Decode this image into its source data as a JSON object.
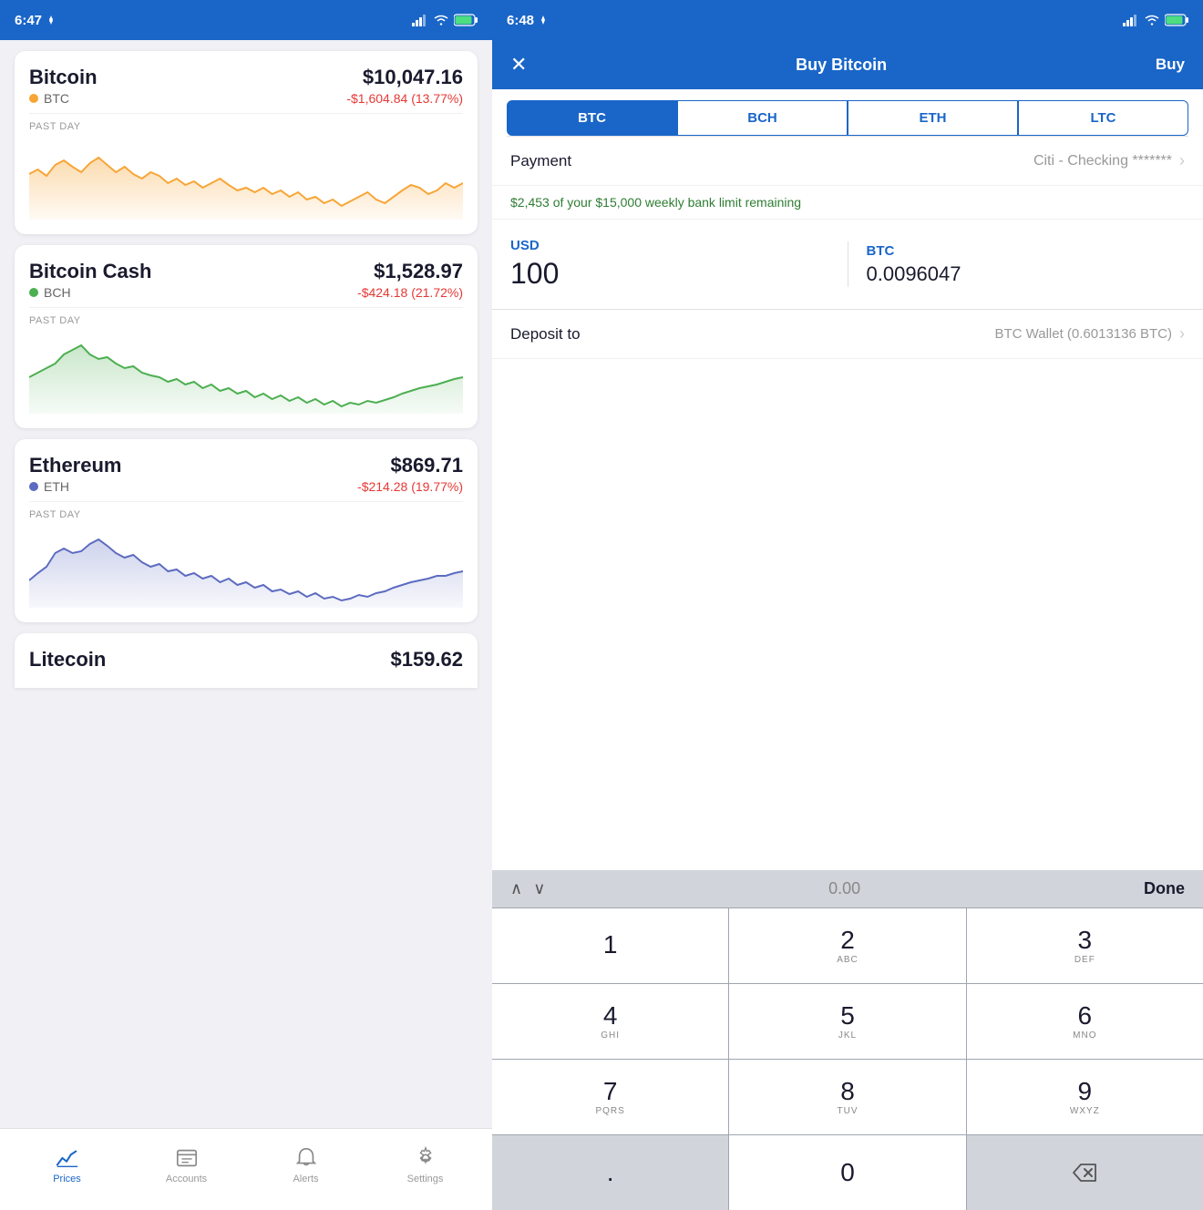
{
  "left": {
    "status_bar": {
      "time": "6:47",
      "location_icon": "location-arrow-icon",
      "signal_icon": "signal-icon",
      "wifi_icon": "wifi-icon",
      "battery_icon": "battery-icon"
    },
    "coins": [
      {
        "name": "Bitcoin",
        "ticker": "BTC",
        "dot_color": "#f7a535",
        "price": "$10,047.16",
        "change": "-$1,604.84 (13.77%)",
        "past_day_label": "PAST DAY",
        "chart_color": "#f7a535",
        "chart_fill": "#fef3dc"
      },
      {
        "name": "Bitcoin Cash",
        "ticker": "BCH",
        "dot_color": "#4caf50",
        "price": "$1,528.97",
        "change": "-$424.18 (21.72%)",
        "past_day_label": "PAST DAY",
        "chart_color": "#4caf50",
        "chart_fill": "#e8f5e9"
      },
      {
        "name": "Ethereum",
        "ticker": "ETH",
        "dot_color": "#5c6bc0",
        "price": "$869.71",
        "change": "-$214.28 (19.77%)",
        "past_day_label": "PAST DAY",
        "chart_color": "#6070c8",
        "chart_fill": "#e8eaf6"
      }
    ],
    "litecoin_partial": {
      "name": "Litecoin",
      "price": "$159.62"
    },
    "bottom_nav": [
      {
        "label": "Prices",
        "active": true,
        "icon": "prices-icon"
      },
      {
        "label": "Accounts",
        "active": false,
        "icon": "accounts-icon"
      },
      {
        "label": "Alerts",
        "active": false,
        "icon": "alerts-icon"
      },
      {
        "label": "Settings",
        "active": false,
        "icon": "settings-icon"
      }
    ]
  },
  "right": {
    "status_bar": {
      "time": "6:48",
      "location_icon": "location-arrow-icon",
      "signal_icon": "signal-icon",
      "wifi_icon": "wifi-icon",
      "battery_icon": "battery-icon"
    },
    "header": {
      "close_label": "✕",
      "title": "Buy Bitcoin",
      "action_label": "Buy"
    },
    "tabs": [
      {
        "label": "BTC",
        "active": true
      },
      {
        "label": "BCH",
        "active": false
      },
      {
        "label": "ETH",
        "active": false
      },
      {
        "label": "LTC",
        "active": false
      }
    ],
    "payment": {
      "label": "Payment",
      "value": "Citi - Checking *******"
    },
    "weekly_limit_msg": "$2,453 of your $15,000 weekly bank limit remaining",
    "usd": {
      "label": "USD",
      "value": "100"
    },
    "btc": {
      "label": "BTC",
      "value": "0.0096047"
    },
    "deposit": {
      "label": "Deposit to",
      "value": "BTC Wallet (0.6013136 BTC)"
    },
    "keypad": {
      "up_arrow": "∧",
      "down_arrow": "∨",
      "preview": "0.00",
      "done_label": "Done",
      "keys": [
        {
          "main": "1",
          "sub": ""
        },
        {
          "main": "2",
          "sub": "ABC"
        },
        {
          "main": "3",
          "sub": "DEF"
        },
        {
          "main": "4",
          "sub": "GHI"
        },
        {
          "main": "5",
          "sub": "JKL"
        },
        {
          "main": "6",
          "sub": "MNO"
        },
        {
          "main": "7",
          "sub": "PQRS"
        },
        {
          "main": "8",
          "sub": "TUV"
        },
        {
          "main": "9",
          "sub": "WXYZ"
        },
        {
          "main": ".",
          "sub": ""
        },
        {
          "main": "0",
          "sub": ""
        },
        {
          "main": "⌫",
          "sub": ""
        }
      ]
    }
  }
}
